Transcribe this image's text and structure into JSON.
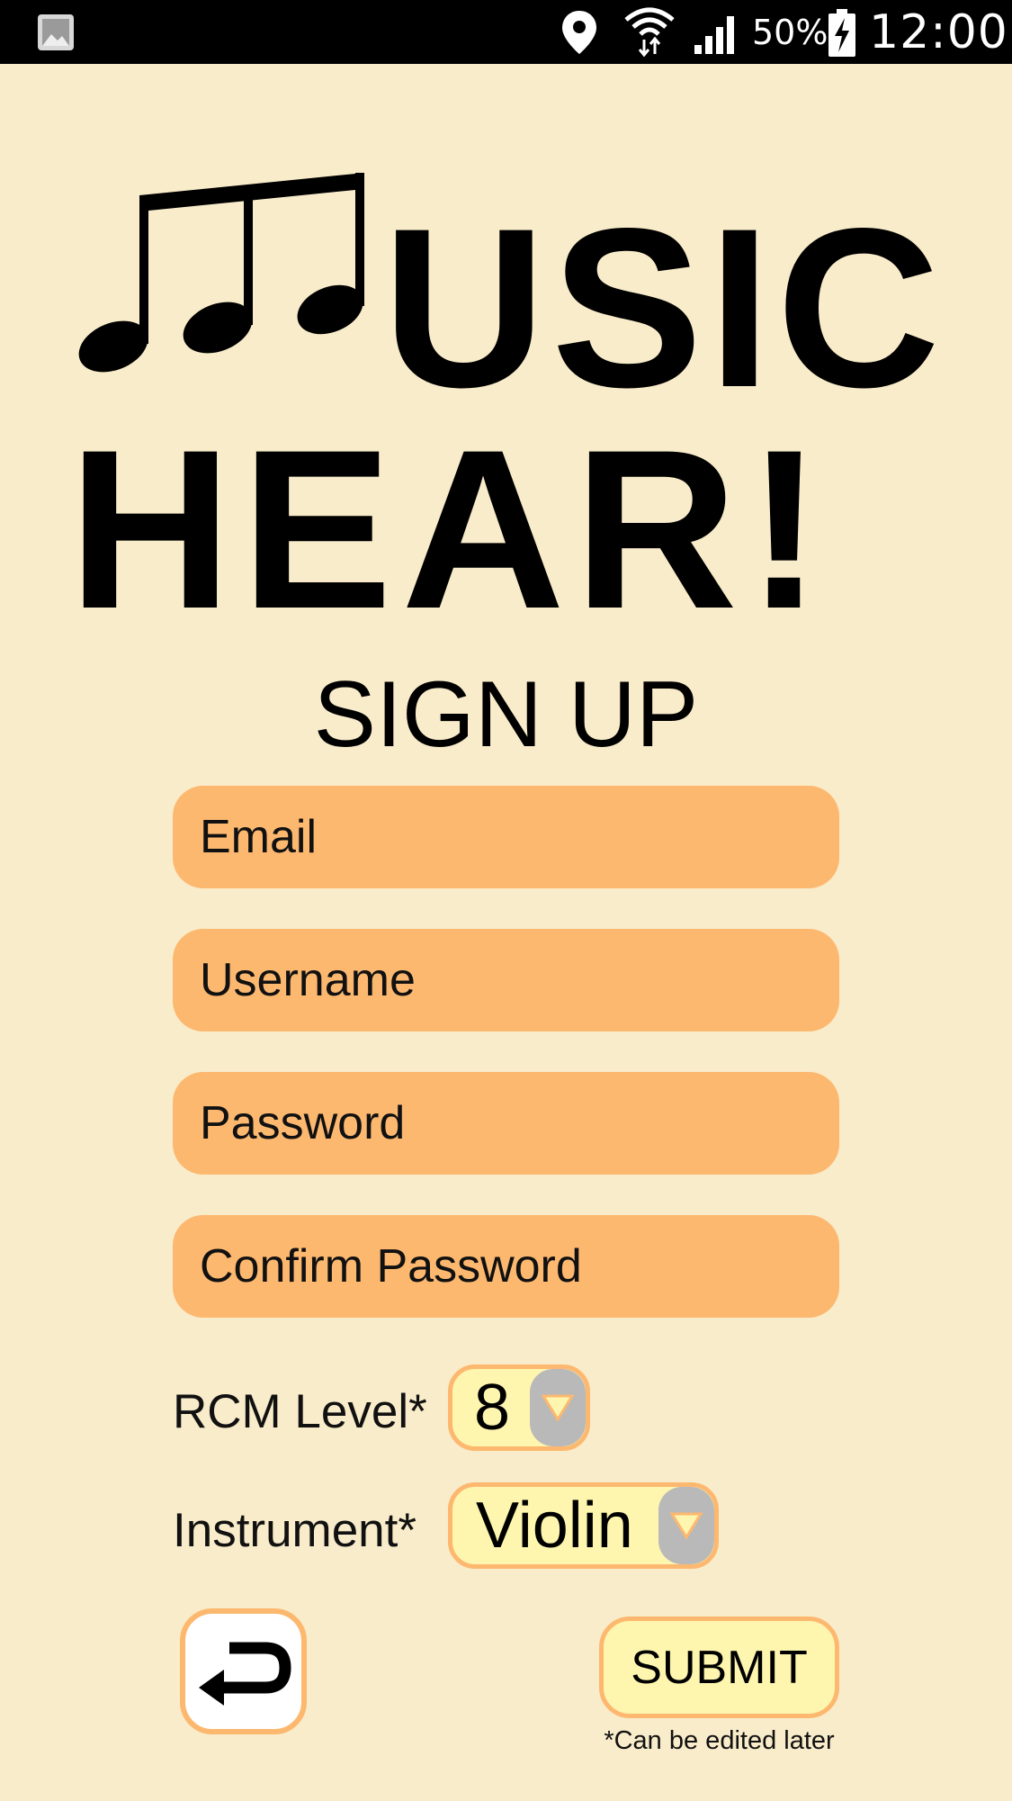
{
  "status_bar": {
    "battery_percent": "50%",
    "time": "12:00",
    "icons": [
      "gallery-notification-icon",
      "location-icon",
      "wifi-icon",
      "cell-signal-icon",
      "battery-charging-icon"
    ]
  },
  "logo": {
    "line1": "USIC",
    "line2": "HEAR!",
    "notes_icon": "beamed-notes-icon"
  },
  "page_title": "SIGN UP",
  "form": {
    "email_placeholder": "Email",
    "username_placeholder": "Username",
    "password_placeholder": "Password",
    "confirm_password_placeholder": "Confirm Password",
    "rcm_level_label": "RCM Level*",
    "rcm_level_value": "8",
    "instrument_label": "Instrument*",
    "instrument_value": "Violin"
  },
  "actions": {
    "back_icon": "return-arrow-icon",
    "submit_label": "SUBMIT",
    "footnote": "*Can be edited later"
  },
  "colors": {
    "background": "#f9ecca",
    "field": "#fdb870",
    "select_fill": "#fef6ae",
    "arrow_bg": "#b9b9b9"
  }
}
